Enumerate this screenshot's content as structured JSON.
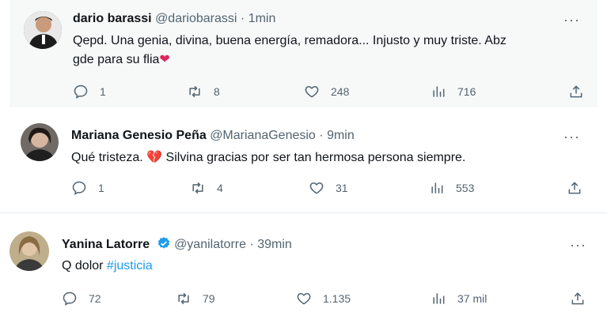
{
  "tweets": [
    {
      "display_name": "dario barassi",
      "handle": "@dariobarassi",
      "separator": "·",
      "time": "1min",
      "text_line1": "Qepd. Una genia, divina, buena energía, remadora... Injusto y muy triste. Abz",
      "text_line2": "gde para su flia",
      "emoji": "❤",
      "replies": "1",
      "retweets": "8",
      "likes": "248",
      "views": "716"
    },
    {
      "display_name": "Mariana Genesio Peña",
      "handle": "@MarianaGenesio",
      "separator": "·",
      "time": "9min",
      "text_prefix": "Qué tristeza.",
      "emoji": "💔",
      "text_suffix": "Silvina gracias por ser tan hermosa persona siempre.",
      "replies": "1",
      "retweets": "4",
      "likes": "31",
      "views": "553"
    },
    {
      "display_name": "Yanina Latorre",
      "handle": "@yanilatorre",
      "separator": "·",
      "time": "39min",
      "text_prefix": "Q dolor",
      "hashtag": "#justicia",
      "replies": "72",
      "retweets": "79",
      "likes": "1.135",
      "views": "37 mil"
    }
  ],
  "more_label": "···",
  "colors": {
    "text": "#0f1419",
    "secondary": "#536471",
    "link": "#1d9bf0",
    "heart": "#f91880",
    "verified": "#1d9bf0"
  }
}
